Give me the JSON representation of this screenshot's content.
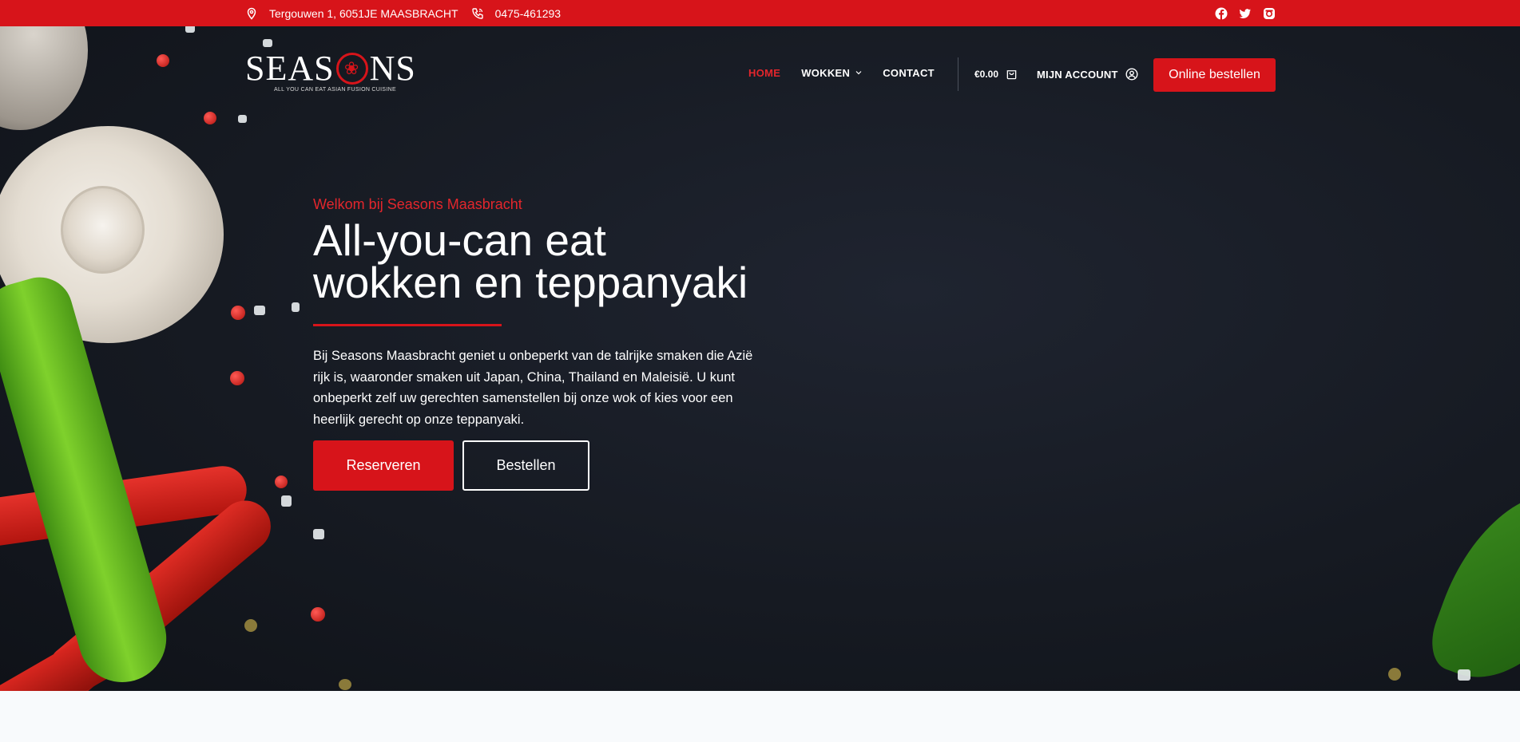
{
  "topbar": {
    "address": "Tergouwen 1, 6051JE MAASBRACHT",
    "phone": "0475-461293",
    "social": [
      "facebook-icon",
      "twitter-icon",
      "instagram-icon"
    ]
  },
  "brand": {
    "name_left": "SEAS",
    "name_right": "NS",
    "tagline": "ALL YOU CAN EAT ASIAN FUSION CUISINE",
    "accent_color": "#d7141a"
  },
  "nav": {
    "items": [
      {
        "label": "HOME",
        "active": true
      },
      {
        "label": "WOKKEN",
        "dropdown": true
      },
      {
        "label": "CONTACT"
      }
    ],
    "cart_total": "€0.00",
    "account_label": "MIJN ACCOUNT",
    "order_button": "Online bestellen"
  },
  "hero": {
    "welcome": "Welkom bij Seasons Maasbracht",
    "headline_line1": "All-you-can eat",
    "headline_line2": "wokken en teppanyaki",
    "description": "Bij Seasons Maasbracht geniet u onbeperkt van de talrijke smaken die Azië rijk is, waaronder smaken uit Japan, China, Thailand en Maleisië. U kunt onbeperkt zelf uw gerechten samenstellen bij onze wok of kies voor een heerlijk gerecht op onze teppanyaki.",
    "primary_button": "Reserveren",
    "secondary_button": "Bestellen"
  }
}
